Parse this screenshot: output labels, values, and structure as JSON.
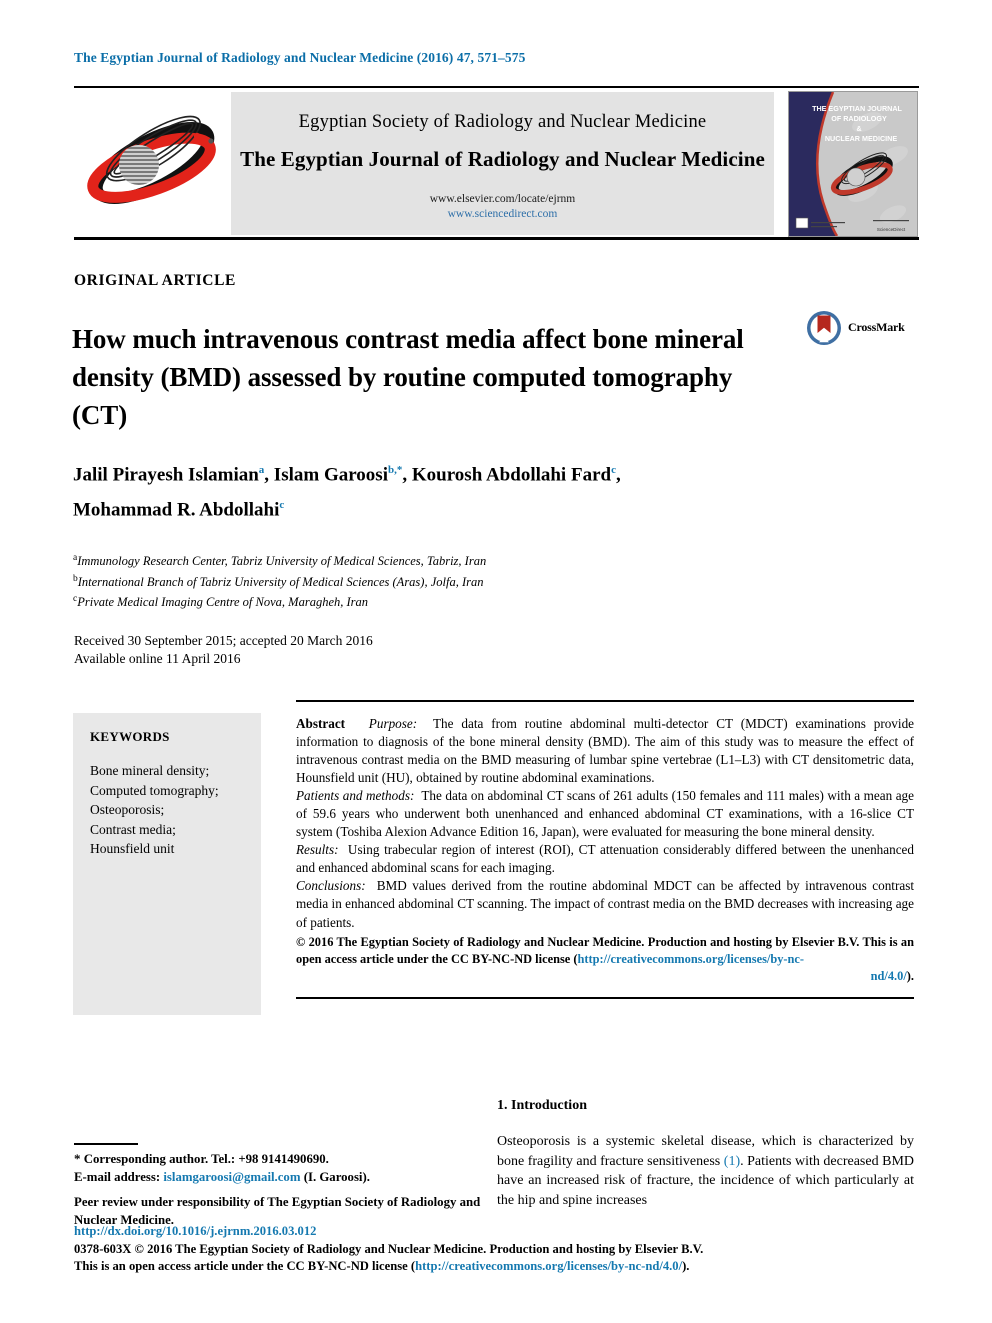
{
  "running_head": "The Egyptian Journal of Radiology and Nuclear Medicine (2016) 47, 571–575",
  "masthead": {
    "society_name": "Egyptian Society of Radiology and Nuclear Medicine",
    "journal_name": "The Egyptian Journal of Radiology and Nuclear Medicine",
    "url_publisher": "www.elsevier.com/locate/ejrnm",
    "url_platform": "www.sciencedirect.com",
    "society_logo_icon": "orbiting-atom-logo-icon",
    "cover_thumb_icon": "journal-cover-thumbnail",
    "cover_title_line1": "THE EGYPTIAN JOURNAL",
    "cover_title_line2": "OF RADIOLOGY",
    "cover_title_line3": "&",
    "cover_title_line4": "NUCLEAR MEDICINE"
  },
  "article": {
    "type": "ORIGINAL ARTICLE",
    "title": "How much intravenous contrast media affect bone mineral density (BMD) assessed by routine computed tomography (CT)",
    "crossmark_label": "CrossMark",
    "crossmark_icon": "crossmark-badge-icon"
  },
  "authors": {
    "line1_a": "Jalil Pirayesh Islamian",
    "sup1": "a",
    "line1_b": ", Islam Garoosi",
    "sup2": "b,",
    "sup2star": "*",
    "line1_c": ", Kourosh Abdollahi Fard",
    "sup3": "c",
    "line1_d": ",",
    "line2": "Mohammad R. Abdollahi",
    "sup4": "c"
  },
  "affiliations": [
    {
      "marker": "a",
      "text": "Immunology Research Center, Tabriz University of Medical Sciences, Tabriz, Iran"
    },
    {
      "marker": "b",
      "text": "International Branch of Tabriz University of Medical Sciences (Aras), Jolfa, Iran"
    },
    {
      "marker": "c",
      "text": "Private Medical Imaging Centre of Nova, Maragheh, Iran"
    }
  ],
  "history": {
    "line1": "Received 30 September 2015; accepted 20 March 2016",
    "line2": "Available online 11 April 2016"
  },
  "keywords": {
    "heading": "KEYWORDS",
    "items": [
      "Bone mineral density;",
      "Computed tomography;",
      "Osteoporosis;",
      "Contrast media;",
      "Hounsfield unit"
    ]
  },
  "abstract": {
    "label": "Abstract",
    "purpose_label": "Purpose:",
    "purpose_text": "The data from routine abdominal multi-detector CT (MDCT) examinations provide information to diagnosis of the bone mineral density (BMD). The aim of this study was to measure the effect of intravenous contrast media on the BMD measuring of lumbar spine vertebrae (L1–L3) with CT densitometric data, Hounsfield unit (HU), obtained by routine abdominal examinations.",
    "methods_label": "Patients and methods:",
    "methods_text": "The data on abdominal CT scans of 261 adults (150 females and 111 males) with a mean age of 59.6 years who underwent both unenhanced and enhanced abdominal CT examinations, with a 16-slice CT system (Toshiba Alexion Advance Edition 16, Japan), were evaluated for measuring the bone mineral density.",
    "results_label": "Results:",
    "results_text": "Using trabecular region of interest (ROI), CT attenuation considerably differed between the unenhanced and enhanced abdominal scans for each imaging.",
    "conclusions_label": "Conclusions:",
    "conclusions_text": "BMD values derived from the routine abdominal MDCT can be affected by intravenous contrast media in enhanced abdominal CT scanning. The impact of contrast media on the BMD decreases with increasing age of patients.",
    "copyright_line1": "© 2016 The Egyptian Society of Radiology and Nuclear Medicine. Production and hosting by Elsevier B.V.",
    "copyright_line2_pre": "This is an open access article under the CC BY-NC-ND license (",
    "copyright_link": "http://creativecommons.org/licenses/by-nc-",
    "copyright_link_tail": "nd/4.0/",
    "copyright_tail_close": ")."
  },
  "introduction": {
    "heading": "1. Introduction",
    "text_pre": "Osteoporosis is a systemic skeletal disease, which is characterized by bone fragility and fracture sensitiveness ",
    "citation": "(1)",
    "text_post": ". Patients with decreased BMD have an increased risk of fracture, the incidence of which particularly at the hip and spine increases"
  },
  "footnotes": {
    "corresponding_star": "*",
    "corresponding": "Corresponding author. Tel.: +98 9141490690.",
    "email_label": "E-mail address:",
    "email": "islamgaroosi@gmail.com",
    "email_suffix": "(I. Garoosi).",
    "peer_review": "Peer review under responsibility of The Egyptian Society of Radiology and Nuclear Medicine."
  },
  "publisher_block": {
    "doi": "http://dx.doi.org/10.1016/j.ejrnm.2016.03.012",
    "issn_line": "0378-603X © 2016 The Egyptian Society of Radiology and Nuclear Medicine. Production and hosting by Elsevier B.V.",
    "license_pre": "This is an open access article under the CC BY-NC-ND license (",
    "license_link": "http://creativecommons.org/licenses/by-nc-nd/4.0/",
    "license_post": ")."
  },
  "colors": {
    "link_blue": "#1579b0",
    "running_head_blue": "#0b6ea8",
    "logo_red": "#e2231a",
    "cover_navy": "#2b2a5e"
  }
}
